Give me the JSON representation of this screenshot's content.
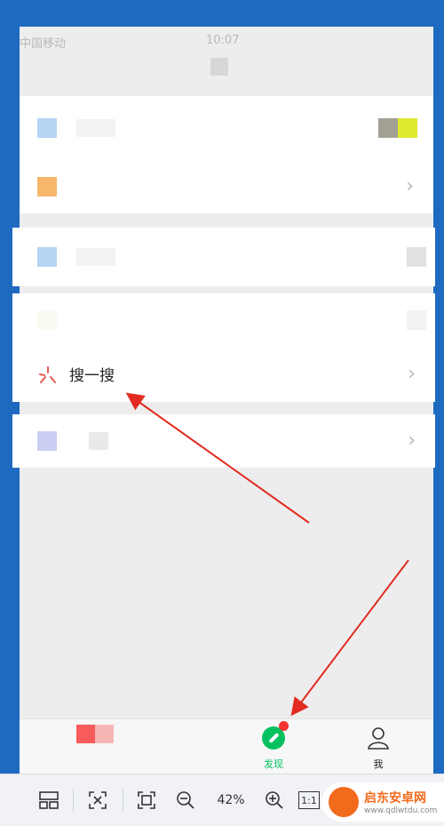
{
  "statusbar": {
    "carrier": "中国移动",
    "time": "10:07"
  },
  "discover": {
    "search_label": "搜一搜"
  },
  "tabbar": {
    "discover_label": "发现",
    "me_label": "我"
  },
  "viewer": {
    "zoom": "42%",
    "actual_size": "1:1"
  },
  "watermark": {
    "title": "启东安卓网",
    "url": "www.qdlwtdu.com"
  },
  "colors": {
    "wechat_green": "#07c160",
    "badge_red": "#f43530",
    "arrow_red": "#e22b20"
  }
}
